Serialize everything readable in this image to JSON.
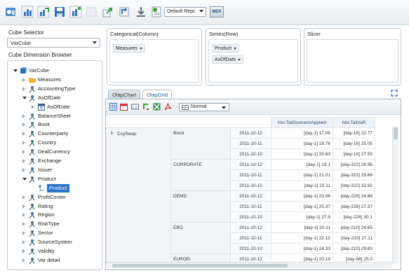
{
  "toolbar": {
    "icons": [
      "report-icon",
      "bar-chart-icon",
      "chart-grow-icon",
      "save-icon",
      "save-chart-icon",
      "disabled-icon",
      "move-icon",
      "swap-icon",
      "download-icon",
      "checklist-icon"
    ],
    "report_select": "Default Repc",
    "mdx_label": "MDX"
  },
  "cube_selector": {
    "label": "Cube Selector",
    "value": "VarCube"
  },
  "browser": {
    "label": "Cube Dimension Browser",
    "items": [
      {
        "label": "VarCube",
        "icon": "cube-icon",
        "state": "open"
      },
      {
        "label": "Measures",
        "icon": "folder-icon",
        "state": "closed"
      },
      {
        "label": "AccountingType",
        "icon": "dimension-icon",
        "state": "closed"
      },
      {
        "label": "AsOfDate",
        "icon": "dimension-icon",
        "state": "open"
      },
      {
        "label": "AsOfDate",
        "icon": "calendar-icon",
        "state": "closed"
      },
      {
        "label": "BalanceSheet",
        "icon": "dimension-icon",
        "state": "closed"
      },
      {
        "label": "Book",
        "icon": "dimension-icon",
        "state": "closed"
      },
      {
        "label": "Counterparty",
        "icon": "dimension-icon",
        "state": "closed"
      },
      {
        "label": "Country",
        "icon": "dimension-icon",
        "state": "closed"
      },
      {
        "label": "DealCurrency",
        "icon": "dimension-icon",
        "state": "closed"
      },
      {
        "label": "Exchange",
        "icon": "dimension-icon",
        "state": "closed"
      },
      {
        "label": "Issuer",
        "icon": "dimension-icon",
        "state": "closed"
      },
      {
        "label": "Product",
        "icon": "dimension-icon",
        "state": "open"
      },
      {
        "label": "Product",
        "icon": "hierarchy-icon",
        "state": "selected"
      },
      {
        "label": "ProfitCenter",
        "icon": "dimension-icon",
        "state": "closed"
      },
      {
        "label": "Rating",
        "icon": "dimension-icon",
        "state": "closed"
      },
      {
        "label": "Region",
        "icon": "dimension-icon",
        "state": "closed"
      },
      {
        "label": "RiskType",
        "icon": "dimension-icon",
        "state": "closed"
      },
      {
        "label": "Sector",
        "icon": "dimension-icon",
        "state": "closed"
      },
      {
        "label": "SourceSystem",
        "icon": "dimension-icon",
        "state": "closed"
      },
      {
        "label": "Validity",
        "icon": "dimension-icon",
        "state": "closed"
      },
      {
        "label": "Var detail",
        "icon": "dimension-icon",
        "state": "closed"
      }
    ]
  },
  "panels": {
    "categorical": {
      "title": "Categorical(Column)",
      "chips": [
        "Measures"
      ]
    },
    "series": {
      "title": "Series(Row)",
      "chips": [
        "Product",
        "AsOfDate"
      ]
    },
    "slicer": {
      "title": "Slicer"
    }
  },
  "tabs": [
    "OlapChart",
    "OlapGrid"
  ],
  "grid": {
    "view_mode": "Normal",
    "columns": [
      "hist.TailScenarioApplied",
      "hist.TailVaR"
    ],
    "root": "CcySwap",
    "groups": [
      {
        "name": "Bond",
        "rows": [
          {
            "date": "2011-10-12",
            "v1": "[day-1] 17.05",
            "v2": "[day-16] 22.77"
          },
          {
            "date": "2011-10-11",
            "v1": "[day-1] 18.76",
            "v2": "[day-16] 25.05"
          },
          {
            "date": "2011-10-10",
            "v1": "[day-1] 20.63",
            "v2": "[day-16] 27.55"
          }
        ]
      },
      {
        "name": "CORPORATE",
        "rows": [
          {
            "date": "2011-10-12",
            "v1": "[day-1] 19.1",
            "v2": "[day-322] 26.96"
          },
          {
            "date": "2011-10-11",
            "v1": "[day-1] 21.01",
            "v2": "[day-322] 29.66"
          },
          {
            "date": "2011-10-10",
            "v1": "[day-1] 23.11",
            "v2": "[day-322] 32.62"
          }
        ]
      },
      {
        "name": "DEMD",
        "rows": [
          {
            "date": "2011-10-12",
            "v1": "[day-1] 23.06",
            "v2": "[day-226] 24.88"
          },
          {
            "date": "2011-10-11",
            "v1": "[day-1] 25.37",
            "v2": "[day-226] 27.37"
          },
          {
            "date": "2011-10-10",
            "v1": "[day-1] 27.9",
            "v2": "[day-226] 30.1"
          }
        ]
      },
      {
        "name": "EBO",
        "rows": [
          {
            "date": "2011-10-12",
            "v1": "[day-1] 20.11",
            "v2": "[day-210] 24.65"
          },
          {
            "date": "2011-10-11",
            "v1": "[day-1] 22.12",
            "v2": "[day-210] 27.11"
          },
          {
            "date": "2011-10-10",
            "v1": "[day-1] 24.33",
            "v2": "[day-210] 29.83"
          }
        ]
      },
      {
        "name": "EUROEi",
        "rows": [
          {
            "date": "2011-10-12",
            "v1": "[day-1] 20.19",
            "v2": "[day-56] 25.0"
          }
        ]
      }
    ]
  }
}
